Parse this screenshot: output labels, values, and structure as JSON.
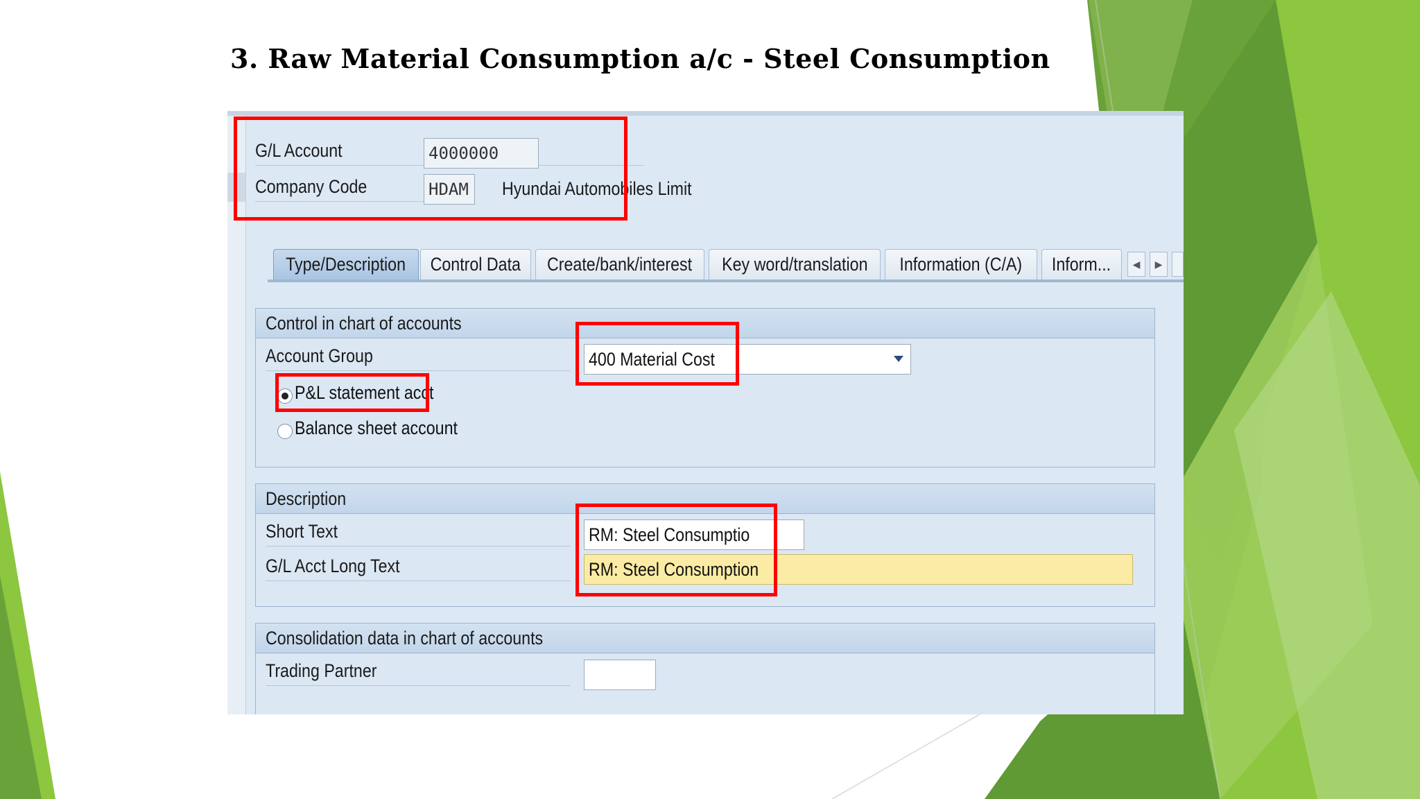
{
  "slide": {
    "title": "3. Raw Material Consumption a/c - Steel Consumption"
  },
  "header": {
    "gl_account_label": "G/L Account",
    "gl_account_value": "4000000",
    "company_code_label": "Company Code",
    "company_code_value": "HDAM",
    "company_name": "Hyundai Automobiles Limit"
  },
  "tabs": [
    {
      "label": "Type/Description",
      "active": true
    },
    {
      "label": "Control Data",
      "active": false
    },
    {
      "label": "Create/bank/interest",
      "active": false
    },
    {
      "label": "Key word/translation",
      "active": false
    },
    {
      "label": "Information (C/A)",
      "active": false
    },
    {
      "label": "Inform...",
      "active": false
    }
  ],
  "control": {
    "section_title": "Control in chart of accounts",
    "account_group_label": "Account Group",
    "account_group_value": "400 Material Cost",
    "radio_pl_label": "P&L statement acct",
    "radio_bs_label": "Balance sheet account",
    "selected": "P&L statement acct"
  },
  "description": {
    "section_title": "Description",
    "short_text_label": "Short Text",
    "short_text_value": "RM: Steel Consumptio",
    "long_text_label": "G/L Acct Long Text",
    "long_text_value": "RM: Steel Consumption"
  },
  "consolidation": {
    "section_title": "Consolidation data in chart of accounts",
    "trading_partner_label": "Trading Partner",
    "trading_partner_value": ""
  },
  "colors": {
    "highlight": "#ff0000",
    "sap_background": "#dce8f4",
    "required_field": "#fbeba4",
    "slide_green_light": "#8dc63f",
    "slide_green_dark": "#5f9a35"
  }
}
